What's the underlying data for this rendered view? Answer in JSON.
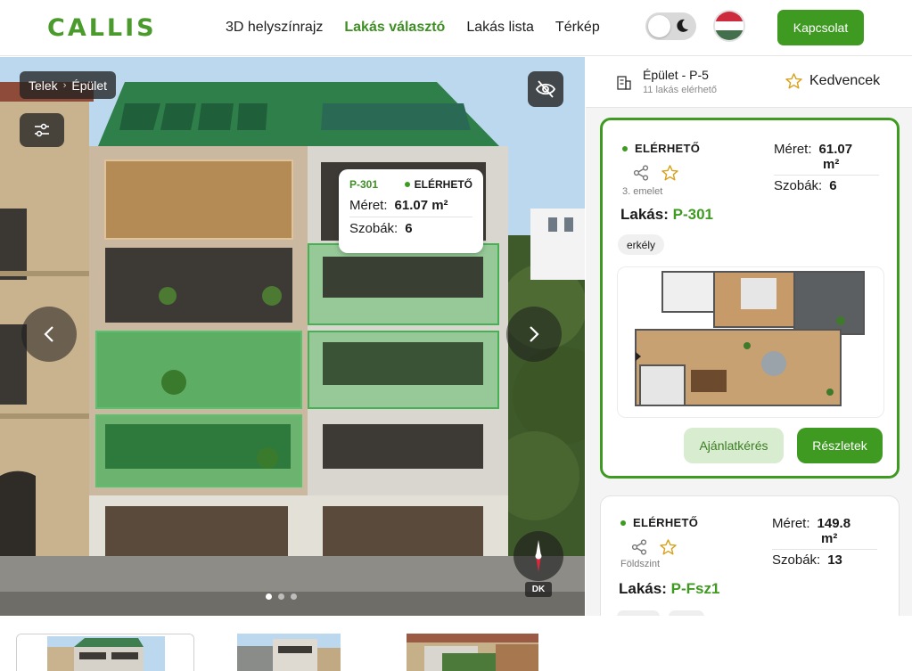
{
  "header": {
    "logo": "CALLIS",
    "nav": [
      {
        "label": "3D helyszínrajz",
        "active": false
      },
      {
        "label": "Lakás választó",
        "active": true
      },
      {
        "label": "Lakás lista",
        "active": false
      },
      {
        "label": "Térkép",
        "active": false
      }
    ],
    "contact_label": "Kapcsolat",
    "accent_color": "#3f9a22"
  },
  "hero": {
    "breadcrumb": [
      "Telek",
      "Épület"
    ],
    "compass_label": "DK",
    "tooltip": {
      "code": "P-301",
      "status": "ELÉRHETŐ",
      "size_label": "Méret:",
      "size_value": "61.07 m²",
      "rooms_label": "Szobák:",
      "rooms_value": "6"
    },
    "slide_count": 3,
    "active_slide": 0
  },
  "sidebar": {
    "building_title": "Épület - P-5",
    "building_sub": "11 lakás elérhető",
    "favorites_label": "Kedvencek",
    "cards": [
      {
        "status": "ELÉRHETŐ",
        "floor": "3. emelet",
        "lakas_label": "Lakás:",
        "code": "P-301",
        "size_label": "Méret:",
        "size_value": "61.07",
        "size_unit": "m²",
        "rooms_label": "Szobák:",
        "rooms_value": "6",
        "tag": "erkély",
        "offer_label": "Ajánlatkérés",
        "details_label": "Részletek"
      },
      {
        "status": "ELÉRHETŐ",
        "floor": "Földszint",
        "lakas_label": "Lakás:",
        "code": "P-Fsz1",
        "size_label": "Méret:",
        "size_value": "149.8",
        "size_unit": "m²",
        "rooms_label": "Szobák:",
        "rooms_value": "13"
      }
    ]
  }
}
